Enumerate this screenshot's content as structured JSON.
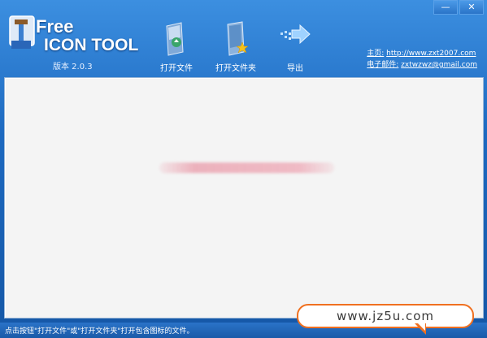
{
  "window": {
    "minimize_glyph": "—",
    "close_glyph": "✕"
  },
  "logo": {
    "line1": "Free",
    "line2": "ICON TOOL",
    "version": "版本 2.0.3"
  },
  "toolbar": {
    "open_file": "打开文件",
    "open_folder": "打开文件夹",
    "export": "导出"
  },
  "contact": {
    "homepage_label": "主页:",
    "homepage_url": "http://www.zxt2007.com",
    "email_label": "电子邮件:",
    "email": "zxtwzwz@gmail.com"
  },
  "status": {
    "text": "点击按钮\"打开文件\"或\"打开文件夹\"打开包含图标的文件。"
  },
  "watermark": {
    "text": "www.jz5u.com"
  },
  "colors": {
    "title_blue": "#1d69c0",
    "client_bg": "#f4f4f4",
    "watermark_border": "#f07020"
  }
}
